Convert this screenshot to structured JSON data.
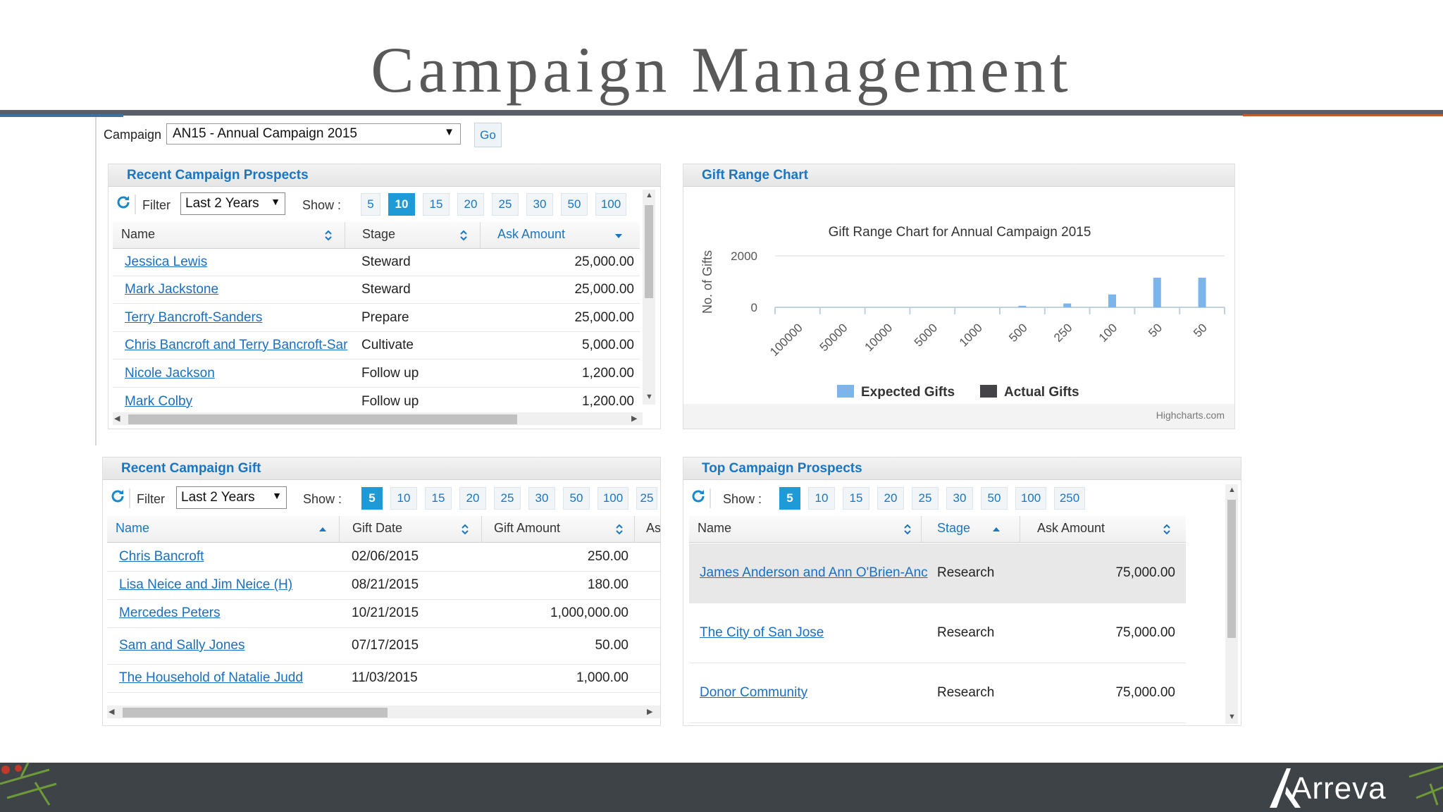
{
  "slide": {
    "title": "Campaign Management"
  },
  "campaign": {
    "label": "Campaign",
    "selected": "AN15 - Annual Campaign 2015",
    "go_label": "Go"
  },
  "recent_prospects": {
    "title": "Recent Campaign Prospects",
    "filter_label": "Filter",
    "filter_value": "Last 2 Years",
    "show_label": "Show :",
    "page_sizes": [
      "5",
      "10",
      "15",
      "20",
      "25",
      "30",
      "50",
      "100"
    ],
    "active_page_size": "10",
    "columns": [
      "Name",
      "Stage",
      "Ask Amount"
    ],
    "rows": [
      {
        "name": "Jessica Lewis",
        "stage": "Steward",
        "amount": "25,000.00"
      },
      {
        "name": "Mark Jackstone",
        "stage": "Steward",
        "amount": "25,000.00"
      },
      {
        "name": "Terry Bancroft-Sanders",
        "stage": "Prepare",
        "amount": "25,000.00"
      },
      {
        "name": "Chris Bancroft and Terry Bancroft-Sar",
        "stage": "Cultivate",
        "amount": "5,000.00"
      },
      {
        "name": "Nicole Jackson",
        "stage": "Follow up",
        "amount": "1,200.00"
      },
      {
        "name": "Mark Colby",
        "stage": "Follow up",
        "amount": "1,200.00"
      }
    ]
  },
  "gift_range": {
    "panel_title": "Gift Range Chart",
    "credit": "Highcharts.com"
  },
  "chart_data": {
    "type": "bar",
    "title": "Gift Range Chart for Annual Campaign 2015",
    "xlabel": "",
    "ylabel": "No. of Gifts",
    "categories": [
      "100000",
      "50000",
      "10000",
      "5000",
      "1000",
      "500",
      "250",
      "100",
      "50",
      "50"
    ],
    "series": [
      {
        "name": "Expected Gifts",
        "color": "#7cb5ec",
        "values": [
          0,
          0,
          0,
          0,
          0,
          60,
          150,
          500,
          1150,
          1150
        ]
      },
      {
        "name": "Actual Gifts",
        "color": "#434348",
        "values": [
          0,
          0,
          0,
          0,
          0,
          0,
          0,
          0,
          0,
          0
        ]
      }
    ],
    "yticks": [
      0,
      2000
    ],
    "ylim": [
      0,
      2000
    ],
    "grid": true,
    "legend": "bottom"
  },
  "recent_gifts": {
    "title": "Recent Campaign Gift",
    "filter_label": "Filter",
    "filter_value": "Last 2 Years",
    "show_label": "Show :",
    "page_sizes": [
      "5",
      "10",
      "15",
      "20",
      "25",
      "30",
      "50",
      "100",
      "25"
    ],
    "active_page_size": "5",
    "columns": [
      "Name",
      "Gift Date",
      "Gift Amount",
      "As"
    ],
    "rows": [
      {
        "name": "Chris Bancroft",
        "date": "02/06/2015",
        "amount": "250.00"
      },
      {
        "name": "Lisa Neice and Jim Neice (H)",
        "date": "08/21/2015",
        "amount": "180.00"
      },
      {
        "name": "Mercedes Peters",
        "date": "10/21/2015",
        "amount": "1,000,000.00"
      },
      {
        "name": "Sam and Sally Jones",
        "date": "07/17/2015",
        "amount": "50.00"
      },
      {
        "name": "The Household of Natalie Judd",
        "date": "11/03/2015",
        "amount": "1,000.00"
      }
    ]
  },
  "top_prospects": {
    "title": "Top Campaign Prospects",
    "show_label": "Show :",
    "page_sizes": [
      "5",
      "10",
      "15",
      "20",
      "25",
      "30",
      "50",
      "100",
      "250"
    ],
    "active_page_size": "5",
    "columns": [
      "Name",
      "Stage",
      "Ask Amount"
    ],
    "rows": [
      {
        "name": "James Anderson and Ann O'Brien-Anc",
        "stage": "Research",
        "amount": "75,000.00"
      },
      {
        "name": "The City of San Jose",
        "stage": "Research",
        "amount": "75,000.00"
      },
      {
        "name": "Donor Community",
        "stage": "Research",
        "amount": "75,000.00"
      }
    ]
  },
  "footer": {
    "brand": "Arreva"
  }
}
